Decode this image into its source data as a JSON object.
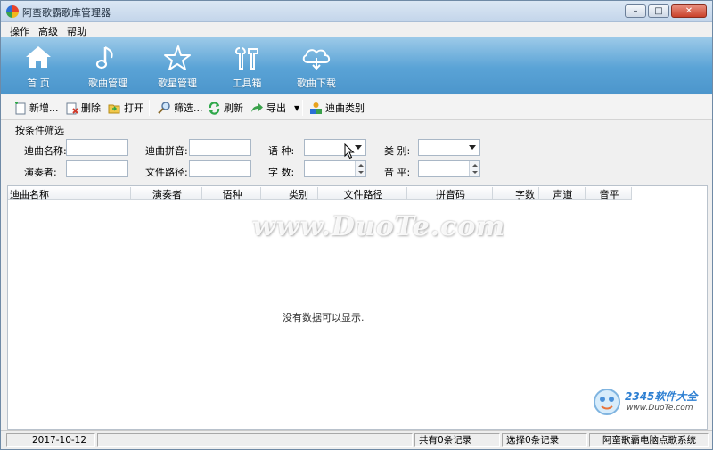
{
  "window": {
    "title": "阿蛮歌霸歌库管理器"
  },
  "menu": [
    "操作",
    "高级",
    "帮助"
  ],
  "nav": [
    {
      "label": "首  页",
      "icon": "home-icon"
    },
    {
      "label": "歌曲管理",
      "icon": "music-note-icon"
    },
    {
      "label": "歌星管理",
      "icon": "star-icon"
    },
    {
      "label": "工具箱",
      "icon": "tools-icon"
    },
    {
      "label": "歌曲下载",
      "icon": "cloud-download-icon"
    }
  ],
  "toolbar": {
    "add": "新增...",
    "delete": "删除",
    "open": "打开",
    "filter": "筛选...",
    "refresh": "刷新",
    "export": "导出",
    "category": "迪曲类别"
  },
  "filter": {
    "title": "按条件筛选",
    "song_name": "迪曲名称:",
    "song_pinyin": "迪曲拼音:",
    "language": "语    种:",
    "type": "类    别:",
    "singer": "演奏者:",
    "file_path": "文件路径:",
    "word_count": "字    数:",
    "volume": "音    平:"
  },
  "grid": {
    "columns": [
      "迪曲名称",
      "演奏者",
      "语种",
      "类别",
      "文件路径",
      "拼音码",
      "字数",
      "声道",
      "音平"
    ],
    "empty_text": "没有数据可以显示."
  },
  "watermark": {
    "duote": "www.DuoTe.com",
    "brand": "2345软件大全",
    "url": "www.DuoTe.com"
  },
  "status": {
    "date": "2017-10-12",
    "total": "共有0条记录",
    "selected": "选择0条记录",
    "system": "阿蛮歌霸电脑点歌系统"
  },
  "colors": {
    "ribbon": "#5aa3d6",
    "titlebar": "#c3d5ea",
    "close": "#c9412a"
  }
}
